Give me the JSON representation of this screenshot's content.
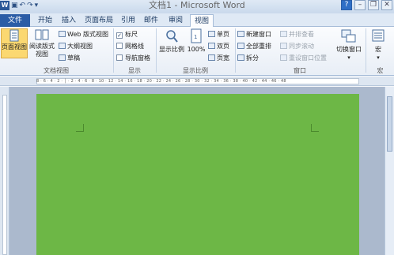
{
  "window": {
    "title": "文档1 - Microsoft Word",
    "qat_icons": [
      "word-icon",
      "save-icon",
      "undo-icon",
      "redo-icon",
      "customize-icon"
    ],
    "controls": [
      "help-icon",
      "minimize-icon",
      "restore-icon",
      "close-icon"
    ]
  },
  "tabs": {
    "file": "文件",
    "items": [
      "开始",
      "插入",
      "页面布局",
      "引用",
      "邮件",
      "审阅",
      "视图"
    ],
    "active": "视图"
  },
  "ribbon": {
    "views": {
      "print_layout": "页面视图",
      "full_screen_reading": "阅读版式视图",
      "web_layout": "Web 版式视图",
      "outline": "大纲视图",
      "draft": "草稿",
      "group_label": "文档视图"
    },
    "show": {
      "ruler": {
        "label": "标尺",
        "checked": true
      },
      "gridlines": {
        "label": "网格线",
        "checked": false
      },
      "nav_pane": {
        "label": "导航窗格",
        "checked": false
      },
      "group_label": "显示"
    },
    "zoom": {
      "zoom": "显示比例",
      "hundred": "100%",
      "one_page": "单页",
      "two_pages": "双页",
      "page_width": "页宽",
      "group_label": "显示比例"
    },
    "window": {
      "new_window": "新建窗口",
      "arrange_all": "全部重排",
      "split": "拆分",
      "side_by_side": "并排查看",
      "sync_scroll": "同步滚动",
      "reset_position": "重设窗口位置",
      "switch_windows": "切换窗口",
      "group_label": "窗口"
    },
    "macros": {
      "macros": "宏",
      "group_label": "宏"
    }
  },
  "ruler": {
    "ticks": "8 · 6 · 4 · 2 · │ · 2 · 4 · 6 · 8 · 10 · 12 · 14 · 16 · 18 · 20 · 22 · 24 · 26 · 28 · 30 · 32 · 34 · 36 · 38 · 40 · 42 · 44 · 46 · 48"
  },
  "document": {
    "page_color": "#6db746"
  }
}
